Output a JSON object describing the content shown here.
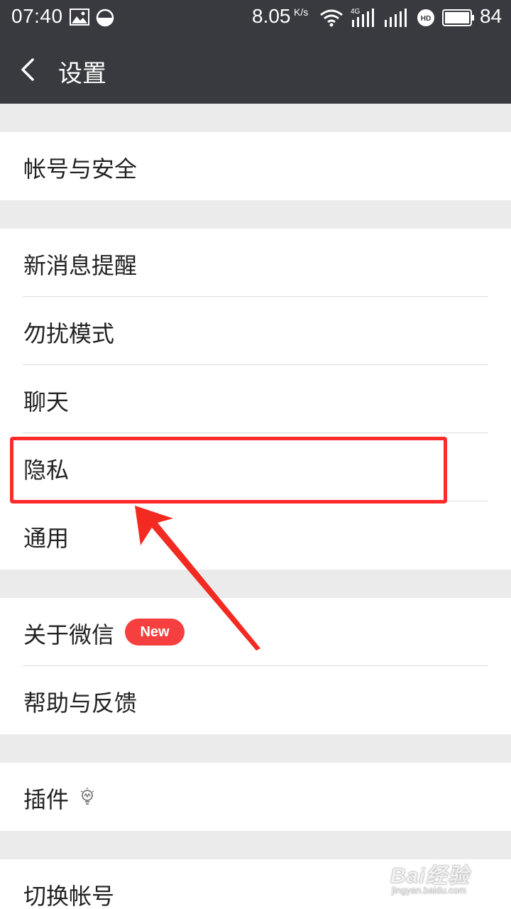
{
  "status_bar": {
    "time": "07:40",
    "speed": "8.05",
    "speed_unit": "K/s",
    "network": "4G",
    "hd": "HD",
    "battery": "84"
  },
  "header": {
    "title": "设置"
  },
  "groups": [
    {
      "items": [
        {
          "label": "帐号与安全"
        }
      ]
    },
    {
      "items": [
        {
          "label": "新消息提醒"
        },
        {
          "label": "勿扰模式"
        },
        {
          "label": "聊天"
        },
        {
          "label": "隐私"
        },
        {
          "label": "通用"
        }
      ]
    },
    {
      "items": [
        {
          "label": "关于微信",
          "badge": "New"
        },
        {
          "label": "帮助与反馈"
        }
      ]
    },
    {
      "items": [
        {
          "label": "插件"
        }
      ]
    },
    {
      "items": [
        {
          "label": "切换帐号"
        }
      ]
    }
  ],
  "annotation": {
    "highlight_color": "#ff2a2a",
    "highlighted_item": "隐私"
  },
  "watermark": {
    "main": "Bai经验",
    "sub": "jingyan.baidu.com"
  },
  "colors": {
    "header_bg": "#393a3f",
    "page_bg": "#ebebeb",
    "badge": "#f64040"
  }
}
